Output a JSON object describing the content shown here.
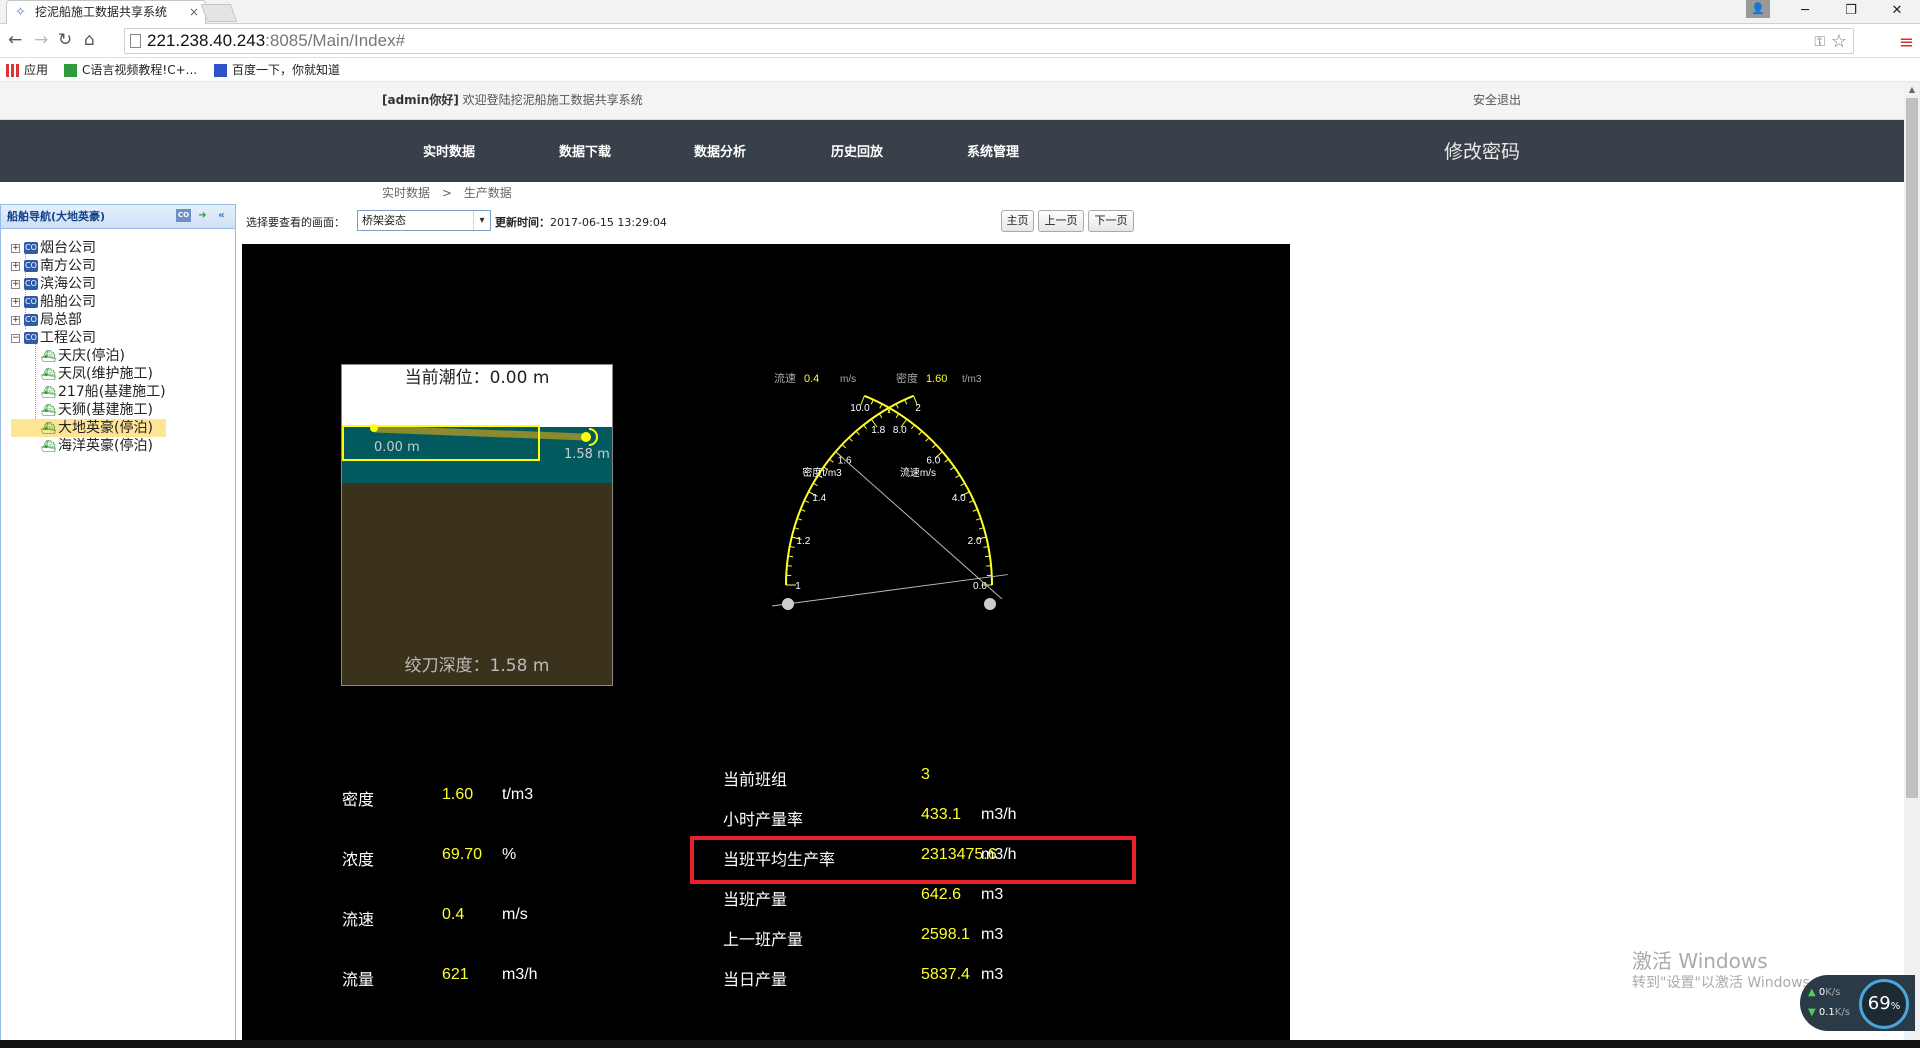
{
  "browser": {
    "tab_title": "挖泥船施工数据共享系统",
    "tab_close": "×",
    "url_host": "221.238.40.243",
    "url_rest": ":8085/Main/Index#",
    "bookmarks": [
      "应用",
      "C语言视频教程!C+...",
      "百度一下，你就知道"
    ]
  },
  "header": {
    "welcome_user": "[admin你好]",
    "welcome_text": " 欢迎登陆挖泥船施工数据共享系统",
    "logout": "安全退出"
  },
  "mainnav": {
    "items": [
      "实时数据",
      "数据下载",
      "数据分析",
      "历史回放",
      "系统管理"
    ],
    "change_password": "修改密码"
  },
  "breadcrumb": {
    "root": "实时数据",
    "sep": ">",
    "current": "生产数据"
  },
  "sidebar": {
    "title": "船舶导航(大地英豪)",
    "companies": [
      "烟台公司",
      "南方公司",
      "滨海公司",
      "船舶公司",
      "局总部",
      "工程公司"
    ],
    "ships": [
      "天庆(停泊)",
      "天凤(维护施工)",
      "217船(基建施工)",
      "天狮(基建施工)",
      "大地英豪(停泊)",
      "海洋英豪(停泊)"
    ],
    "selected_ship": "大地英豪(停泊)"
  },
  "content_toolbar": {
    "select_label": "选择要查看的画面：",
    "selected_view": "桥架姿态",
    "update_label": "更新时间：",
    "update_time": "2017-06-15 13:29:04",
    "buttons": [
      "主页",
      "上一页",
      "下一页"
    ]
  },
  "tide_panel": {
    "tide_label": "当前潮位：0.00 m",
    "left_value": "0.00 m",
    "right_value": "1.58 m",
    "depth_label": "绞刀深度：1.58 m"
  },
  "gauge": {
    "flow_label": "流速",
    "flow_value": "0.4",
    "flow_unit": "m/s",
    "density_label": "密度",
    "density_value": "1.60",
    "density_unit": "t/m3",
    "left_title": "密度t/m3",
    "right_title": "流速m/s",
    "left_ticks": [
      "1",
      "1.2",
      "1.4",
      "1.6",
      "1.8",
      "2"
    ],
    "right_ticks": [
      "0.0",
      "2.0",
      "4.0",
      "6.0",
      "8.0",
      "10.0"
    ],
    "density_needle_value": 1.6,
    "flow_needle_value": 0.4
  },
  "left_stats": [
    {
      "label": "密度",
      "value": "1.60",
      "unit": "t/m3"
    },
    {
      "label": "浓度",
      "value": "69.70",
      "unit": "%"
    },
    {
      "label": "流速",
      "value": "0.4",
      "unit": "m/s"
    },
    {
      "label": "流量",
      "value": "621",
      "unit": "m3/h"
    }
  ],
  "right_stats": [
    {
      "label": "当前班组",
      "value": "3",
      "unit": ""
    },
    {
      "label": "小时产量率",
      "value": "433.1",
      "unit": "m3/h"
    },
    {
      "label": "当班平均生产率",
      "value": "2313475.6",
      "unit": "m3/h"
    },
    {
      "label": "当班产量",
      "value": "642.6",
      "unit": "m3"
    },
    {
      "label": "上一班产量",
      "value": "2598.1",
      "unit": "m3"
    },
    {
      "label": "当日产量",
      "value": "5837.4",
      "unit": "m3"
    }
  ],
  "overlay": {
    "activate_title": "激活 Windows",
    "activate_sub": "转到\"设置\"以激活 Windows",
    "net_up": "0",
    "net_up_unit": "K/s",
    "net_down": "0.1",
    "net_down_unit": "K/s",
    "cpu": "69",
    "cpu_unit": "%"
  },
  "colors": {
    "accent_yellow": "#ffff2a",
    "nav_bg": "#384049",
    "highlight_red": "#e8202a"
  }
}
